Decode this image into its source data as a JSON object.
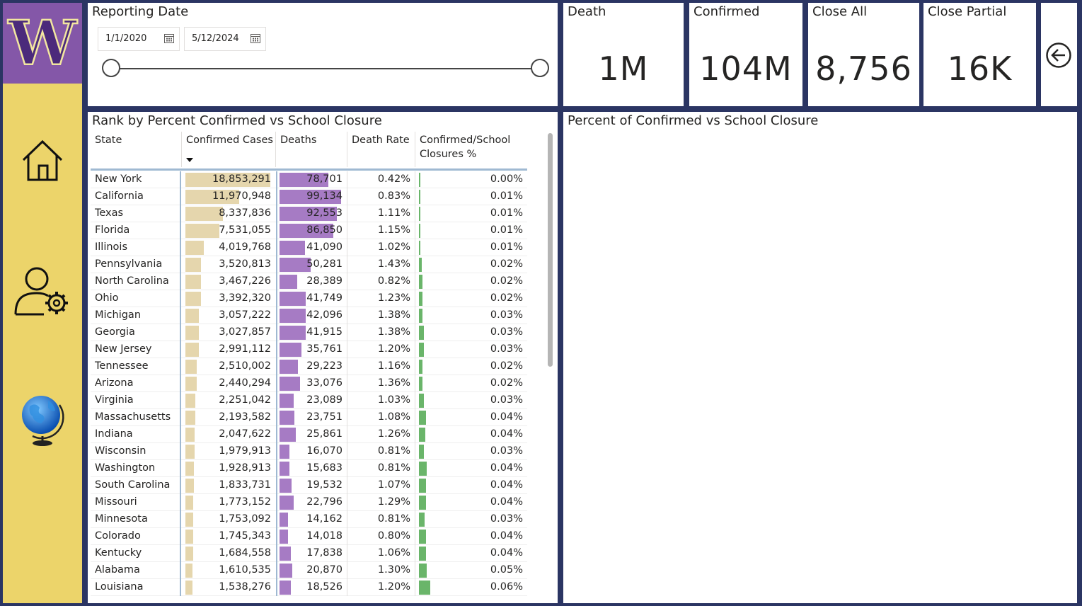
{
  "slicer": {
    "title": "Reporting Date",
    "start_date": "1/1/2020",
    "end_date": "5/12/2024",
    "calendar_icon": "calendar-icon"
  },
  "cards": [
    {
      "title": "Death",
      "value": "1M"
    },
    {
      "title": "Confirmed",
      "value": "104M"
    },
    {
      "title": "Close All",
      "value": "8,756"
    },
    {
      "title": "Close Partial",
      "value": "16K"
    }
  ],
  "nav": {
    "logo_text": "W",
    "icons": [
      "home-icon",
      "user-settings-icon",
      "globe-icon",
      "back-arrow-icon"
    ]
  },
  "table": {
    "title": "Rank by Percent Confirmed vs School Closure",
    "columns": [
      "State",
      "Confirmed Cases",
      "Deaths",
      "Death Rate",
      "Confirmed/School Closures %"
    ],
    "column_wrap": [
      "Confirmed/School",
      "Closures %"
    ],
    "sorted_column": "Confirmed Cases",
    "max_confirmed": 18853291,
    "max_deaths": 99134,
    "max_pct": 0.06,
    "rows": [
      {
        "state": "New York",
        "confirmed": "18,853,291",
        "confirmed_n": 18853291,
        "deaths": "78,701",
        "deaths_n": 78701,
        "death_rate": "0.42%",
        "pct": "0.00%",
        "pct_n": 0.0
      },
      {
        "state": "California",
        "confirmed": "11,970,948",
        "confirmed_n": 11970948,
        "deaths": "99,134",
        "deaths_n": 99134,
        "death_rate": "0.83%",
        "pct": "0.01%",
        "pct_n": 0.003
      },
      {
        "state": "Texas",
        "confirmed": "8,337,836",
        "confirmed_n": 8337836,
        "deaths": "92,553",
        "deaths_n": 92553,
        "death_rate": "1.11%",
        "pct": "0.01%",
        "pct_n": 0.004
      },
      {
        "state": "Florida",
        "confirmed": "7,531,055",
        "confirmed_n": 7531055,
        "deaths": "86,850",
        "deaths_n": 86850,
        "death_rate": "1.15%",
        "pct": "0.01%",
        "pct_n": 0.004
      },
      {
        "state": "Illinois",
        "confirmed": "4,019,768",
        "confirmed_n": 4019768,
        "deaths": "41,090",
        "deaths_n": 41090,
        "death_rate": "1.02%",
        "pct": "0.01%",
        "pct_n": 0.008
      },
      {
        "state": "Pennsylvania",
        "confirmed": "3,520,813",
        "confirmed_n": 3520813,
        "deaths": "50,281",
        "deaths_n": 50281,
        "death_rate": "1.43%",
        "pct": "0.02%",
        "pct_n": 0.016
      },
      {
        "state": "North Carolina",
        "confirmed": "3,467,226",
        "confirmed_n": 3467226,
        "deaths": "28,389",
        "deaths_n": 28389,
        "death_rate": "0.82%",
        "pct": "0.02%",
        "pct_n": 0.017
      },
      {
        "state": "Ohio",
        "confirmed": "3,392,320",
        "confirmed_n": 3392320,
        "deaths": "41,749",
        "deaths_n": 41749,
        "death_rate": "1.23%",
        "pct": "0.02%",
        "pct_n": 0.018
      },
      {
        "state": "Michigan",
        "confirmed": "3,057,222",
        "confirmed_n": 3057222,
        "deaths": "42,096",
        "deaths_n": 42096,
        "death_rate": "1.38%",
        "pct": "0.03%",
        "pct_n": 0.02
      },
      {
        "state": "Georgia",
        "confirmed": "3,027,857",
        "confirmed_n": 3027857,
        "deaths": "41,915",
        "deaths_n": 41915,
        "death_rate": "1.38%",
        "pct": "0.03%",
        "pct_n": 0.025
      },
      {
        "state": "New Jersey",
        "confirmed": "2,991,112",
        "confirmed_n": 2991112,
        "deaths": "35,761",
        "deaths_n": 35761,
        "death_rate": "1.20%",
        "pct": "0.03%",
        "pct_n": 0.025
      },
      {
        "state": "Tennessee",
        "confirmed": "2,510,002",
        "confirmed_n": 2510002,
        "deaths": "29,223",
        "deaths_n": 29223,
        "death_rate": "1.16%",
        "pct": "0.02%",
        "pct_n": 0.02
      },
      {
        "state": "Arizona",
        "confirmed": "2,440,294",
        "confirmed_n": 2440294,
        "deaths": "33,076",
        "deaths_n": 33076,
        "death_rate": "1.36%",
        "pct": "0.02%",
        "pct_n": 0.02
      },
      {
        "state": "Virginia",
        "confirmed": "2,251,042",
        "confirmed_n": 2251042,
        "deaths": "23,089",
        "deaths_n": 23089,
        "death_rate": "1.03%",
        "pct": "0.03%",
        "pct_n": 0.025
      },
      {
        "state": "Massachusetts",
        "confirmed": "2,193,582",
        "confirmed_n": 2193582,
        "deaths": "23,751",
        "deaths_n": 23751,
        "death_rate": "1.08%",
        "pct": "0.04%",
        "pct_n": 0.038
      },
      {
        "state": "Indiana",
        "confirmed": "2,047,622",
        "confirmed_n": 2047622,
        "deaths": "25,861",
        "deaths_n": 25861,
        "death_rate": "1.26%",
        "pct": "0.04%",
        "pct_n": 0.035
      },
      {
        "state": "Wisconsin",
        "confirmed": "1,979,913",
        "confirmed_n": 1979913,
        "deaths": "16,070",
        "deaths_n": 16070,
        "death_rate": "0.81%",
        "pct": "0.03%",
        "pct_n": 0.028
      },
      {
        "state": "Washington",
        "confirmed": "1,928,913",
        "confirmed_n": 1928913,
        "deaths": "15,683",
        "deaths_n": 15683,
        "death_rate": "0.81%",
        "pct": "0.04%",
        "pct_n": 0.04
      },
      {
        "state": "South Carolina",
        "confirmed": "1,833,731",
        "confirmed_n": 1833731,
        "deaths": "19,532",
        "deaths_n": 19532,
        "death_rate": "1.07%",
        "pct": "0.04%",
        "pct_n": 0.038
      },
      {
        "state": "Missouri",
        "confirmed": "1,773,152",
        "confirmed_n": 1773152,
        "deaths": "22,796",
        "deaths_n": 22796,
        "death_rate": "1.29%",
        "pct": "0.04%",
        "pct_n": 0.038
      },
      {
        "state": "Minnesota",
        "confirmed": "1,753,092",
        "confirmed_n": 1753092,
        "deaths": "14,162",
        "deaths_n": 14162,
        "death_rate": "0.81%",
        "pct": "0.03%",
        "pct_n": 0.03
      },
      {
        "state": "Colorado",
        "confirmed": "1,745,343",
        "confirmed_n": 1745343,
        "deaths": "14,018",
        "deaths_n": 14018,
        "death_rate": "0.80%",
        "pct": "0.04%",
        "pct_n": 0.038
      },
      {
        "state": "Kentucky",
        "confirmed": "1,684,558",
        "confirmed_n": 1684558,
        "deaths": "17,838",
        "deaths_n": 17838,
        "death_rate": "1.06%",
        "pct": "0.04%",
        "pct_n": 0.038
      },
      {
        "state": "Alabama",
        "confirmed": "1,610,535",
        "confirmed_n": 1610535,
        "deaths": "20,870",
        "deaths_n": 20870,
        "death_rate": "1.30%",
        "pct": "0.05%",
        "pct_n": 0.042
      },
      {
        "state": "Louisiana",
        "confirmed": "1,538,276",
        "confirmed_n": 1538276,
        "deaths": "18,526",
        "deaths_n": 18526,
        "death_rate": "1.20%",
        "pct": "0.06%",
        "pct_n": 0.06
      }
    ]
  },
  "chart_panel": {
    "title": "Percent of Confirmed vs School Closure"
  },
  "colors": {
    "frame": "#2b3563",
    "sidebar": "#ecd46a",
    "logo_bg": "#8457a8",
    "confirmed_bar": "#e5d6ad",
    "deaths_bar": "#a67bc4",
    "pct_bar": "#6ab56a",
    "header_rule": "#9fb9d2"
  }
}
